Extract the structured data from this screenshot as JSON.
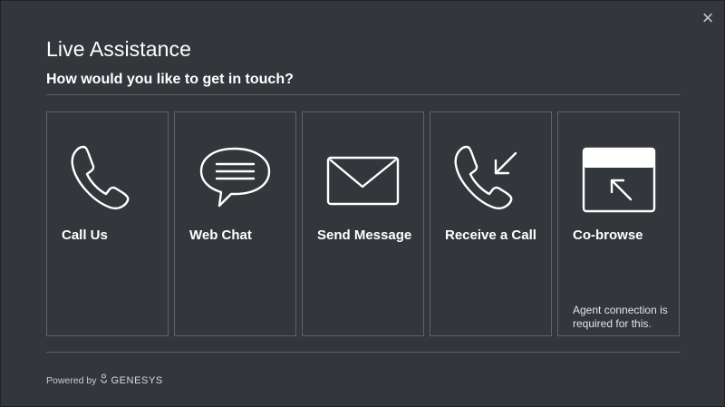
{
  "modal": {
    "close_glyph": "×",
    "title": "Live Assistance",
    "subtitle": "How would you like to get in touch?"
  },
  "options": [
    {
      "label": "Call Us",
      "icon": "phone-icon"
    },
    {
      "label": "Web Chat",
      "icon": "chat-bubble-icon"
    },
    {
      "label": "Send Message",
      "icon": "envelope-icon"
    },
    {
      "label": "Receive a Call",
      "icon": "incoming-call-icon"
    },
    {
      "label": "Co-browse",
      "icon": "cobrowse-window-icon",
      "note": "Agent connection is required for this."
    }
  ],
  "footer": {
    "powered_by": "Powered by",
    "brand": "GENESYS"
  },
  "colors": {
    "modal_background": "#33373b",
    "border": "#5f6368",
    "text": "#ffffff"
  }
}
